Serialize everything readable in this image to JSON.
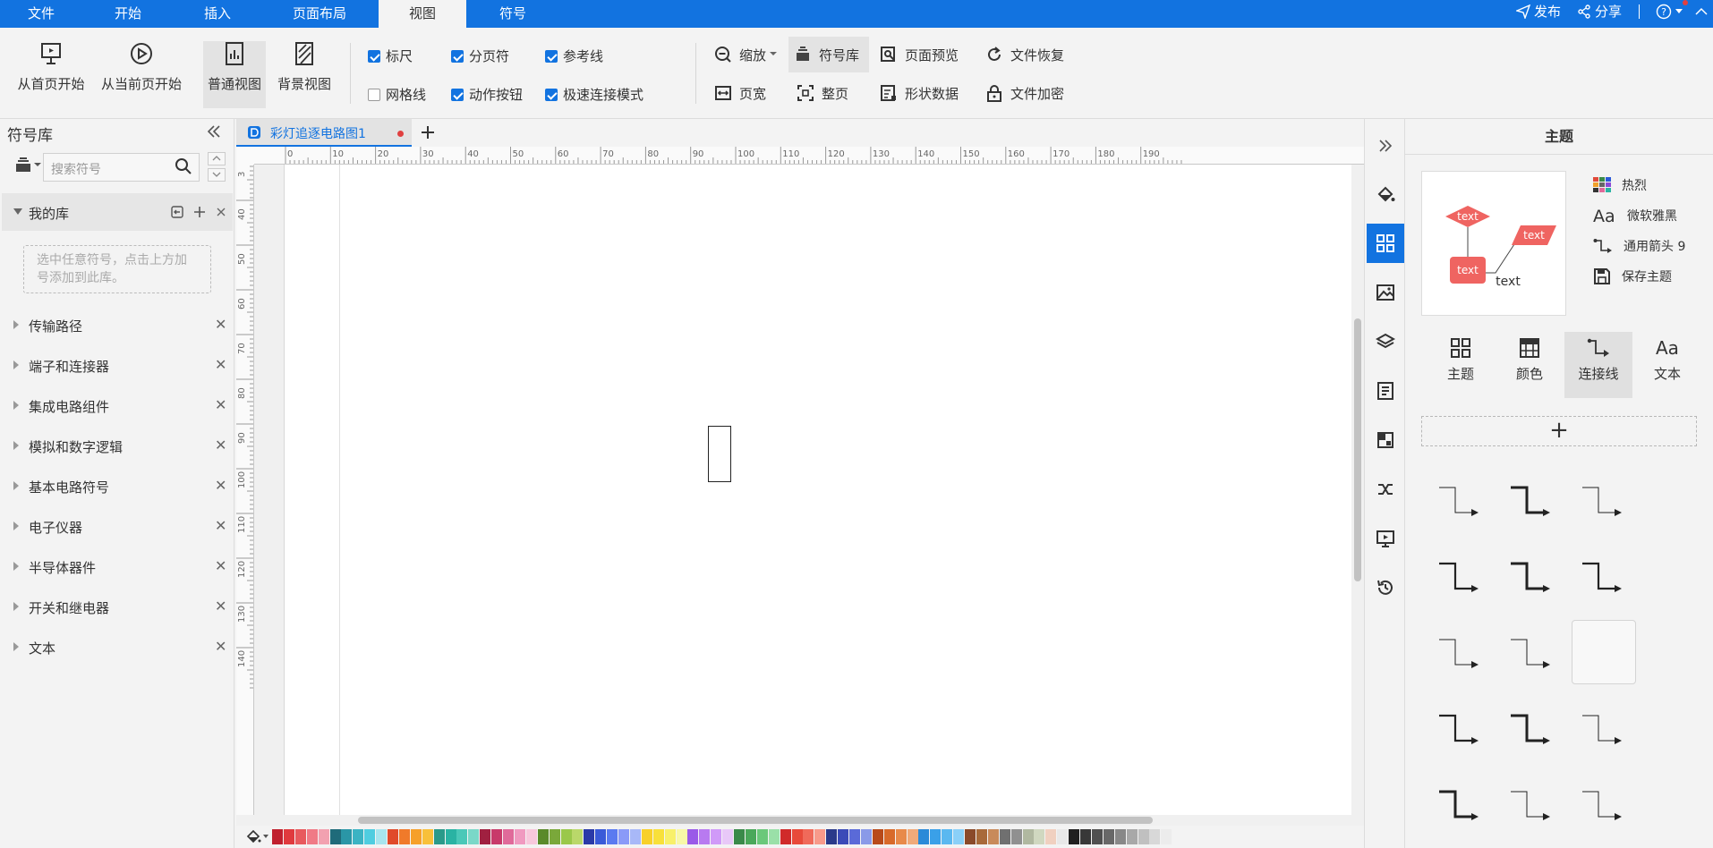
{
  "menu": {
    "tabs": [
      "文件",
      "开始",
      "插入",
      "页面布局",
      "视图",
      "符号"
    ],
    "active_tab": "视图",
    "publish": "发布",
    "share": "分享",
    "help": "?"
  },
  "toolbar": {
    "from_first": "从首页开始",
    "from_current": "从当前页开始",
    "normal_view": "普通视图",
    "background_view": "背景视图",
    "checks": {
      "ruler": "标尺",
      "ruler_on": true,
      "page_break": "分页符",
      "page_break_on": true,
      "guides": "参考线",
      "guides_on": true,
      "grid": "网格线",
      "grid_on": false,
      "action_button": "动作按钮",
      "action_button_on": true,
      "fast_connect": "极速连接模式",
      "fast_connect_on": true
    },
    "zoom": "缩放",
    "symbol_lib": "符号库",
    "page_preview": "页面预览",
    "file_recovery": "文件恢复",
    "page_width": "页宽",
    "whole_page": "整页",
    "shape_data": "形状数据",
    "file_encrypt": "文件加密"
  },
  "left_panel": {
    "title": "符号库",
    "search_placeholder": "搜索符号",
    "my_library": "我的库",
    "drop_hint_1": "选中任意符号，点击上方加",
    "drop_hint_2": "号添加到此库。",
    "categories": [
      "传输路径",
      "端子和连接器",
      "集成电路组件",
      "模拟和数字逻辑",
      "基本电路符号",
      "电子仪器",
      "半导体器件",
      "开关和继电器",
      "文本"
    ]
  },
  "document": {
    "tab_title": "彩灯追逐电路图1",
    "h_ruler": [
      "0",
      "10",
      "20",
      "30",
      "40",
      "50",
      "60",
      "70",
      "80",
      "90",
      "100",
      "110",
      "120",
      "130",
      "140",
      "150",
      "160",
      "170",
      "180",
      "190"
    ],
    "v_ruler": [
      "3",
      "40",
      "50",
      "60",
      "70",
      "80",
      "90",
      "100",
      "110",
      "120",
      "130",
      "140"
    ]
  },
  "palette": [
    "#c0202e",
    "#e03a3e",
    "#e85a5e",
    "#f07a86",
    "#f2a1b0",
    "#1f6b7a",
    "#2a96a6",
    "#3bb3c3",
    "#4fcde0",
    "#a8e5ee",
    "#e04a2a",
    "#f07a2a",
    "#f6a02a",
    "#f8c03a",
    "#2a9a8a",
    "#2ab3a3",
    "#4ac8b8",
    "#7ad8c8",
    "#a02040",
    "#c83a6a",
    "#e06a9a",
    "#f09ac0",
    "#f8c8dc",
    "#5a8a2a",
    "#7aa83a",
    "#9ac84a",
    "#bad86a",
    "#2a3aa8",
    "#3a5ad8",
    "#5a7af0",
    "#8a9af8",
    "#a8b8f8",
    "#f8d02a",
    "#f8e03a",
    "#f8f06a",
    "#f8f8a8",
    "#9a5ae8",
    "#b87af0",
    "#d09af8",
    "#e8c8f8",
    "#3a8a4a",
    "#4aa85a",
    "#6ac87a",
    "#9ae0a8",
    "#d02a2a",
    "#e84a3a",
    "#f06a5a",
    "#f89a8a",
    "#2a3a8a",
    "#3a4ab8",
    "#5a6ad8",
    "#8a9ae8",
    "#b84a1a",
    "#d86a2a",
    "#e88a4a",
    "#f0aa7a",
    "#2a8ad8",
    "#3aa0e8",
    "#5ab8f0",
    "#8ad0f8",
    "#8a4a2a",
    "#a86a3a",
    "#c88a5a",
    "#707070",
    "#909090",
    "#b0b8a0",
    "#d0d8c0",
    "#f0d0c0",
    "#e8e8e8",
    "#202020",
    "#383838",
    "#505050",
    "#686868",
    "#888888",
    "#a8a8a8",
    "#c0c0c0",
    "#d8d8d8",
    "#ececec"
  ],
  "right_panel": {
    "title": "主题",
    "preview_text": "text",
    "options": [
      "热烈",
      "微软雅黑",
      "通用箭头 9",
      "保存主题"
    ],
    "subtabs": [
      "主题",
      "颜色",
      "连接线",
      "文本"
    ],
    "active_subtab": "连接线",
    "add": "+"
  },
  "colors": {
    "accent": "#1273e0",
    "theme_shape": "#ef6461"
  }
}
